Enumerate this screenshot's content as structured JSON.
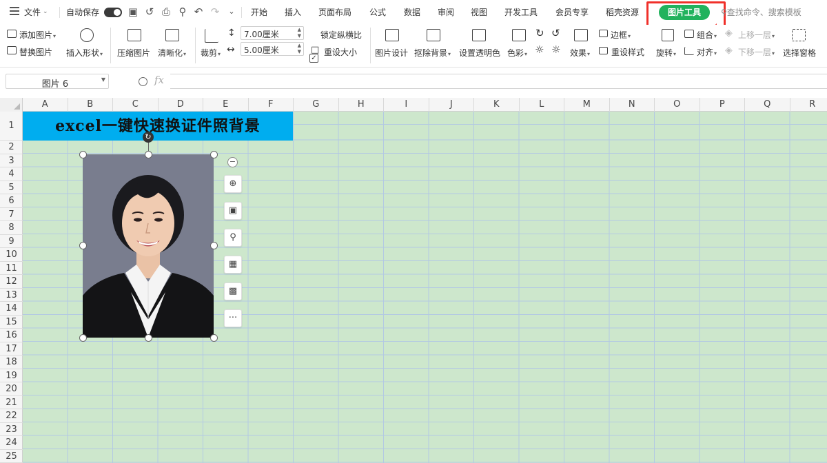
{
  "menubar": {
    "file": "文件",
    "autosave": "自动保存",
    "tabs": [
      "开始",
      "插入",
      "页面布局",
      "公式",
      "数据",
      "审阅",
      "视图",
      "开发工具",
      "会员专享",
      "稻壳资源"
    ],
    "active_tab": "图片工具",
    "search": "查找命令、搜索模板"
  },
  "ribbon": {
    "add_picture": "添加图片",
    "replace_picture": "替换图片",
    "insert_shape": "插入形状",
    "compress_picture": "压缩图片",
    "sharpen": "清晰化",
    "crop": "裁剪",
    "width": "7.00厘米",
    "height": "5.00厘米",
    "lock_ratio": "锁定纵横比",
    "reset_size": "重设大小",
    "picture_design": "图片设计",
    "remove_bg": "抠除背景",
    "set_transparent": "设置透明色",
    "color": "色彩",
    "effects": "效果",
    "border": "边框",
    "reset_style": "重设样式",
    "rotate": "旋转",
    "group": "组合",
    "align": "对齐",
    "bring_forward": "上移一层",
    "send_backward": "下移一层",
    "selection_pane": "选择窗格"
  },
  "formula_bar": {
    "name_box": "图片 6",
    "fx": "fx"
  },
  "grid": {
    "columns": [
      "A",
      "B",
      "C",
      "D",
      "E",
      "F",
      "G",
      "H",
      "I",
      "J",
      "K",
      "L",
      "M",
      "N",
      "O",
      "P",
      "Q",
      "R"
    ],
    "rows": [
      "1",
      "2",
      "3",
      "4",
      "5",
      "6",
      "7",
      "8",
      "9",
      "10",
      "11",
      "12",
      "13",
      "14",
      "15",
      "16",
      "17",
      "18",
      "19",
      "20",
      "21",
      "22",
      "23",
      "24",
      "25"
    ],
    "title": "excel一键快速换证件照背景"
  },
  "side_toolbar": {
    "more": "···"
  },
  "colors": {
    "accent_green": "#21b25d",
    "highlight_red": "#f0302a",
    "title_blue": "#00adef",
    "sheet_bg": "#cde7cc"
  }
}
